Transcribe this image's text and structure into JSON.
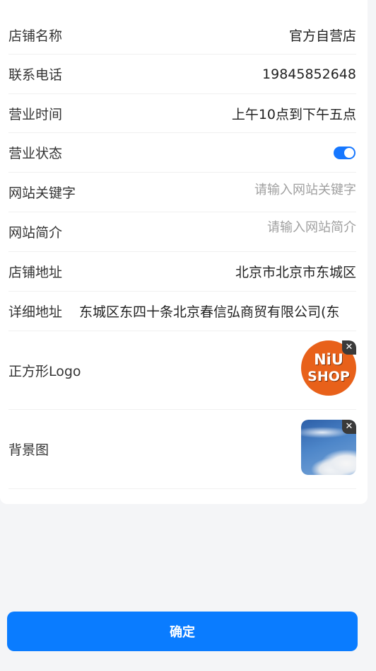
{
  "form": {
    "store_name": {
      "label": "店铺名称",
      "value": "官方自营店"
    },
    "phone": {
      "label": "联系电话",
      "value": "19845852648"
    },
    "hours": {
      "label": "营业时间",
      "value": "上午10点到下午五点"
    },
    "status": {
      "label": "营业状态",
      "enabled": true
    },
    "keywords": {
      "label": "网站关键字",
      "placeholder": "请输入网站关键字",
      "value": ""
    },
    "intro": {
      "label": "网站简介",
      "placeholder": "请输入网站简介",
      "value": ""
    },
    "address": {
      "label": "店铺地址",
      "value": "北京市北京市东城区"
    },
    "detail_address": {
      "label": "详细地址",
      "value": "东城区东四十条北京春信弘商贸有限公司(东"
    },
    "logo": {
      "label": "正方形Logo",
      "text_line1": "NiU",
      "text_line2": "SHOP",
      "remove_icon": "close-icon"
    },
    "background": {
      "label": "背景图",
      "remove_icon": "close-icon"
    }
  },
  "colors": {
    "accent": "#0a7cff",
    "toggle_on": "#1677ff",
    "logo_orange": "#e8611a"
  },
  "actions": {
    "confirm_label": "确定"
  }
}
